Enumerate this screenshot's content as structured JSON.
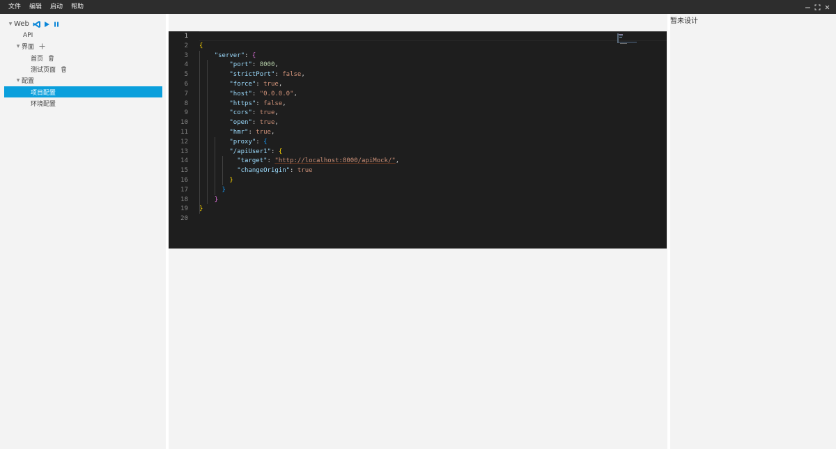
{
  "menubar": {
    "items": [
      "文件",
      "编辑",
      "启动",
      "帮助"
    ],
    "window_controls": [
      "minimize-icon",
      "maximize-icon",
      "close-icon"
    ]
  },
  "sidebar": {
    "root": {
      "label": "Web",
      "actions": [
        "vscode-icon",
        "play-icon",
        "pause-icon"
      ]
    },
    "api": {
      "label": "API"
    },
    "ui_group": {
      "label": "界面",
      "action": "plus-icon"
    },
    "pages": [
      {
        "label": "首页",
        "action": "trash-icon"
      },
      {
        "label": "测试页面",
        "action": "trash-icon"
      }
    ],
    "config_group": {
      "label": "配置"
    },
    "configs": [
      {
        "label": "项目配置",
        "selected": true
      },
      {
        "label": "环境配置",
        "selected": false
      }
    ]
  },
  "editor": {
    "active_line": 1,
    "lines": [
      {
        "n": "1",
        "tokens": []
      },
      {
        "n": "2",
        "tokens": [
          [
            "p1",
            "{"
          ]
        ]
      },
      {
        "n": "3",
        "tokens": [
          [
            "t",
            "    "
          ],
          [
            "k",
            "\"server\""
          ],
          [
            "t",
            ": "
          ],
          [
            "p2",
            "{"
          ]
        ]
      },
      {
        "n": "4",
        "tokens": [
          [
            "t",
            "        "
          ],
          [
            "k",
            "\"port\""
          ],
          [
            "t",
            ": "
          ],
          [
            "n",
            "8000"
          ],
          [
            "t",
            ","
          ]
        ]
      },
      {
        "n": "5",
        "tokens": [
          [
            "t",
            "        "
          ],
          [
            "k",
            "\"strictPort\""
          ],
          [
            "t",
            ": "
          ],
          [
            "s",
            "false"
          ],
          [
            "t",
            ","
          ]
        ]
      },
      {
        "n": "6",
        "tokens": [
          [
            "t",
            "        "
          ],
          [
            "k",
            "\"force\""
          ],
          [
            "t",
            ": "
          ],
          [
            "s",
            "true"
          ],
          [
            "t",
            ","
          ]
        ]
      },
      {
        "n": "7",
        "tokens": [
          [
            "t",
            "        "
          ],
          [
            "k",
            "\"host\""
          ],
          [
            "t",
            ": "
          ],
          [
            "s",
            "\"0.0.0.0\""
          ],
          [
            "t",
            ","
          ]
        ]
      },
      {
        "n": "8",
        "tokens": [
          [
            "t",
            "        "
          ],
          [
            "k",
            "\"https\""
          ],
          [
            "t",
            ": "
          ],
          [
            "s",
            "false"
          ],
          [
            "t",
            ","
          ]
        ]
      },
      {
        "n": "9",
        "tokens": [
          [
            "t",
            "        "
          ],
          [
            "k",
            "\"cors\""
          ],
          [
            "t",
            ": "
          ],
          [
            "s",
            "true"
          ],
          [
            "t",
            ","
          ]
        ]
      },
      {
        "n": "10",
        "tokens": [
          [
            "t",
            "        "
          ],
          [
            "k",
            "\"open\""
          ],
          [
            "t",
            ": "
          ],
          [
            "s",
            "true"
          ],
          [
            "t",
            ","
          ]
        ]
      },
      {
        "n": "11",
        "tokens": [
          [
            "t",
            "        "
          ],
          [
            "k",
            "\"hmr\""
          ],
          [
            "t",
            ": "
          ],
          [
            "s",
            "true"
          ],
          [
            "t",
            ","
          ]
        ]
      },
      {
        "n": "12",
        "tokens": [
          [
            "t",
            "        "
          ],
          [
            "k",
            "\"proxy\""
          ],
          [
            "t",
            ": "
          ],
          [
            "p3",
            "{"
          ]
        ]
      },
      {
        "n": "13",
        "tokens": [
          [
            "t",
            "        "
          ],
          [
            "k",
            "\"/apiUser1\""
          ],
          [
            "t",
            ": "
          ],
          [
            "p1",
            "{"
          ]
        ]
      },
      {
        "n": "14",
        "tokens": [
          [
            "t",
            "          "
          ],
          [
            "k",
            "\"target\""
          ],
          [
            "t",
            ": "
          ],
          [
            "url",
            "\"http://localhost:8000/apiMock/\""
          ],
          [
            "t",
            ","
          ]
        ]
      },
      {
        "n": "15",
        "tokens": [
          [
            "t",
            "          "
          ],
          [
            "k",
            "\"changeOrigin\""
          ],
          [
            "t",
            ": "
          ],
          [
            "s",
            "true"
          ]
        ]
      },
      {
        "n": "16",
        "tokens": [
          [
            "t",
            "        "
          ],
          [
            "p1",
            "}"
          ]
        ]
      },
      {
        "n": "17",
        "tokens": [
          [
            "t",
            "      "
          ],
          [
            "p3",
            "}"
          ]
        ]
      },
      {
        "n": "18",
        "tokens": [
          [
            "t",
            "    "
          ],
          [
            "p2",
            "}"
          ]
        ]
      },
      {
        "n": "19",
        "tokens": [
          [
            "p1",
            "}"
          ]
        ]
      },
      {
        "n": "20",
        "tokens": []
      }
    ]
  },
  "right_panel": {
    "placeholder": "暂未设计"
  },
  "colors": {
    "accent": "#0a9fdc",
    "menubar_bg": "#2d2d2d",
    "editor_bg": "#1e1e1e",
    "panel_bg": "#f3f3f3"
  }
}
